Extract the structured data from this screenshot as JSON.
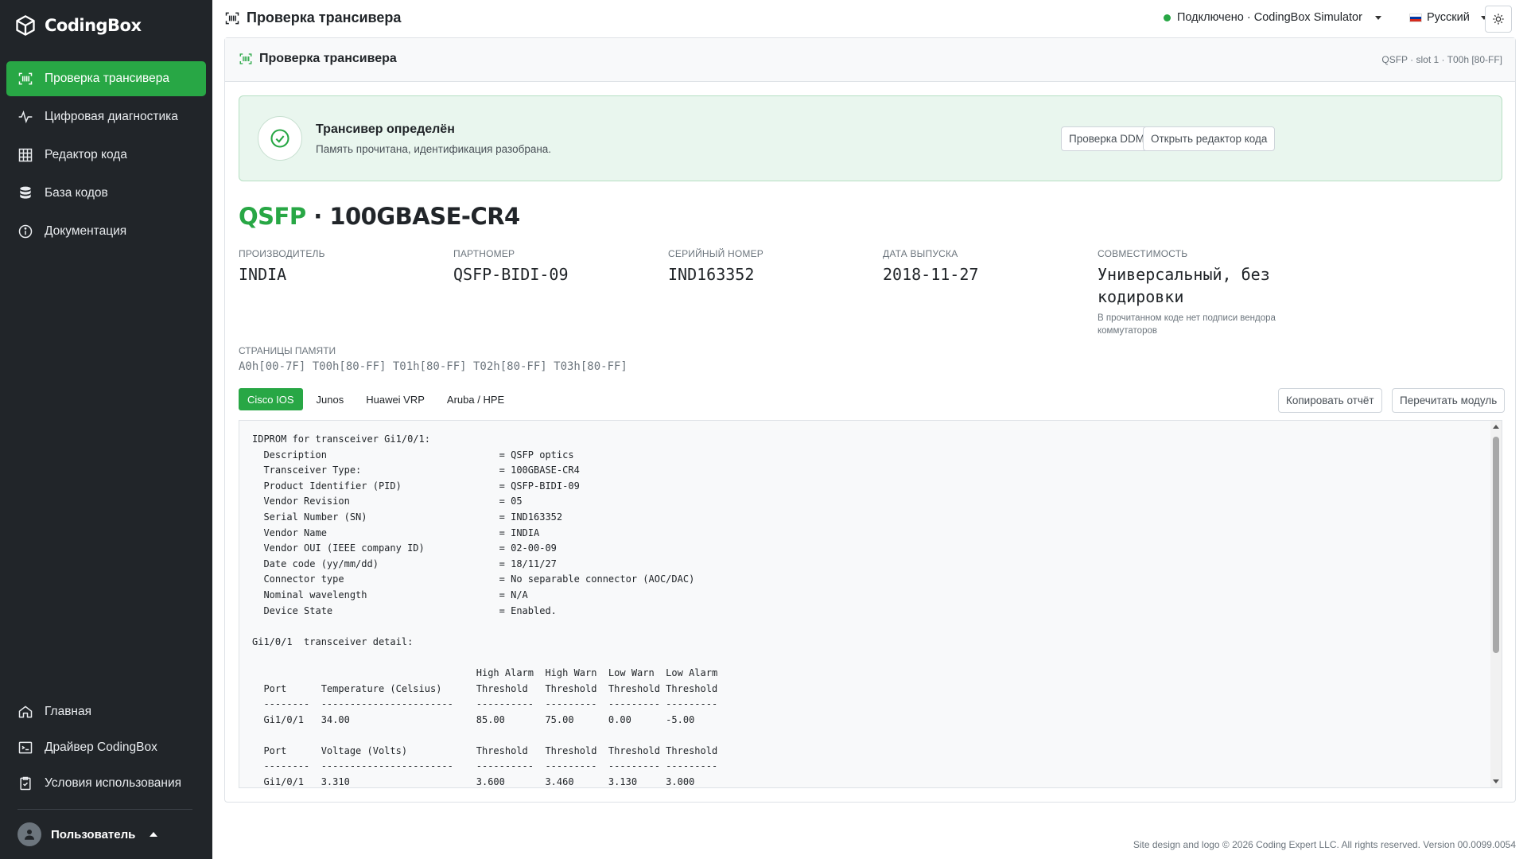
{
  "brand": {
    "name": "CodingBox"
  },
  "sidebar": {
    "items": [
      {
        "label": "Проверка трансивера",
        "icon": "scan-icon",
        "active": true
      },
      {
        "label": "Цифровая диагностика",
        "icon": "pulse-icon"
      },
      {
        "label": "Редактор кода",
        "icon": "grid-icon"
      },
      {
        "label": "База кодов",
        "icon": "database-icon"
      },
      {
        "label": "Документация",
        "icon": "info-icon"
      }
    ],
    "bottom_items": [
      {
        "label": "Главная",
        "icon": "home-icon"
      },
      {
        "label": "Драйвер CodingBox",
        "icon": "terminal-icon"
      },
      {
        "label": "Условия использования",
        "icon": "clipboard-check-icon"
      }
    ],
    "user": {
      "label": "Пользователь"
    }
  },
  "topbar": {
    "title": "Проверка трансивера",
    "connection": "Подключено · CodingBox Simulator",
    "language": "Русский",
    "status_color": "#28a745"
  },
  "card": {
    "title": "Проверка трансивера",
    "meta": "QSFP · slot 1 · T00h [80-FF]",
    "alert": {
      "title": "Трансивер определён",
      "subtitle": "Память прочитана, идентификация разобрана.",
      "btn_ddm": "Проверка DDM",
      "btn_editor": "Открыть редактор кода"
    },
    "module": {
      "type": "QSFP",
      "sep": " · ",
      "name": "100GBASE-CR4"
    },
    "fields": {
      "vendor": {
        "label": "Производитель",
        "value": "INDIA"
      },
      "part": {
        "label": "Партномер",
        "value": "QSFP-BIDI-09"
      },
      "serial": {
        "label": "Серийный номер",
        "value": "IND163352"
      },
      "date": {
        "label": "Дата выпуска",
        "value": "2018-11-27"
      },
      "compat": {
        "label": "Совместимость",
        "value": "Универсальный, без кодировки",
        "note": "В прочитанном коде нет подписи вендора коммутаторов"
      }
    },
    "memory": {
      "label": "Страницы памяти",
      "value": "A0h[00-7F] T00h[80-FF] T01h[80-FF] T02h[80-FF] T03h[80-FF]"
    },
    "tabs": [
      "Cisco IOS",
      "Junos",
      "Huawei VRP",
      "Aruba / HPE"
    ],
    "active_tab": "Cisco IOS",
    "btn_copy": "Копировать отчёт",
    "btn_reread": "Перечитать модуль",
    "code": "IDPROM for transceiver Gi1/0/1:\n  Description                              = QSFP optics\n  Transceiver Type:                        = 100GBASE-CR4\n  Product Identifier (PID)                 = QSFP-BIDI-09\n  Vendor Revision                          = 05\n  Serial Number (SN)                       = IND163352\n  Vendor Name                              = INDIA\n  Vendor OUI (IEEE company ID)             = 02-00-09\n  Date code (yy/mm/dd)                     = 18/11/27\n  Connector type                           = No separable connector (AOC/DAC)\n  Nominal wavelength                       = N/A\n  Device State                             = Enabled.\n\nGi1/0/1  transceiver detail:\n\n                                       High Alarm  High Warn  Low Warn  Low Alarm\n  Port      Temperature (Celsius)      Threshold   Threshold  Threshold Threshold\n  --------  -----------------------    ----------  ---------  --------- ---------\n  Gi1/0/1   34.00                      85.00       75.00      0.00      -5.00\n\n  Port      Voltage (Volts)            Threshold   Threshold  Threshold Threshold\n  --------  -----------------------    ----------  ---------  --------- ---------\n  Gi1/0/1   3.310                      3.600       3.460      3.130     3.000"
  },
  "footer": {
    "text": "Site design and logo © 2026 Coding Expert LLC. All rights reserved. Version 00.0099.0054"
  }
}
